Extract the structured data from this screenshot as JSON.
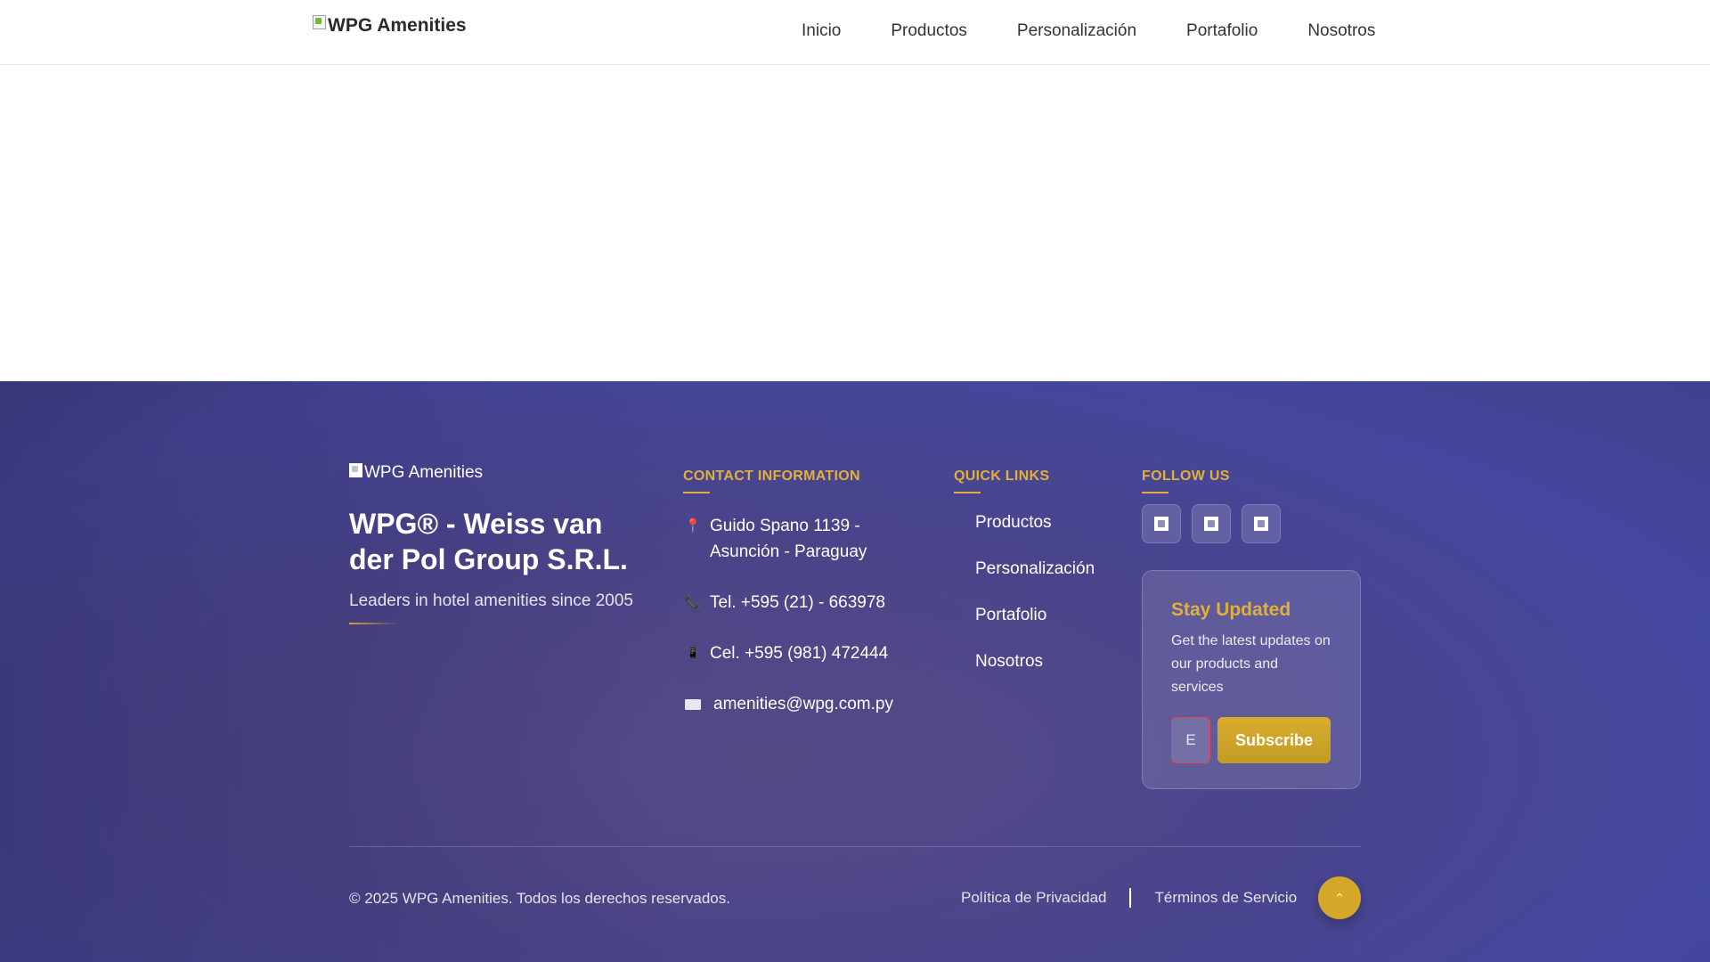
{
  "header": {
    "logo_alt": "WPG Amenities",
    "nav": [
      {
        "label": "Inicio"
      },
      {
        "label": "Productos"
      },
      {
        "label": "Personalización"
      },
      {
        "label": "Portafolio"
      },
      {
        "label": "Nosotros"
      }
    ]
  },
  "footer": {
    "brand": {
      "logo_alt": "WPG Amenities",
      "company": "WPG® - Weiss van der Pol Group S.R.L.",
      "tagline": "Leaders in hotel amenities since 2005"
    },
    "contact": {
      "title": "CONTACT INFORMATION",
      "address": "Guido Spano 1139 - Asunción - Paraguay",
      "tel": "Tel. +595 (21) - 663978",
      "cel": "Cel. +595 (981) 472444",
      "email": "amenities@wpg.com.py"
    },
    "quick_links": {
      "title": "QUICK LINKS",
      "items": [
        {
          "label": "Productos"
        },
        {
          "label": "Personalización"
        },
        {
          "label": "Portafolio"
        },
        {
          "label": "Nosotros"
        }
      ]
    },
    "follow": {
      "title": "FOLLOW US"
    },
    "newsletter": {
      "title": "Stay Updated",
      "text": "Get the latest updates on our products and services",
      "input_value": "E",
      "button": "Subscribe"
    },
    "copyright": "© 2025 WPG Amenities. Todos los derechos reservados.",
    "privacy": "Política de Privacidad",
    "terms": "Términos de Servicio"
  },
  "colors": {
    "accent_gold": "#e2b03a",
    "footer_bg": "#4a4488"
  }
}
